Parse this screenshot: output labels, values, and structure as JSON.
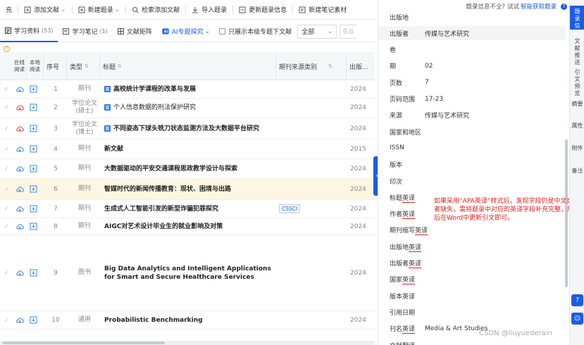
{
  "toolbar": {
    "items": [
      {
        "label": "充",
        "icon": "none"
      },
      {
        "label": "添加文献",
        "icon": "add-doc-icon"
      },
      {
        "label": "新建题录",
        "icon": "new-record-icon"
      },
      {
        "label": "检索添加文献",
        "icon": "search-icon"
      },
      {
        "label": "导入题录",
        "icon": "import-icon"
      },
      {
        "label": "更新题录信息",
        "icon": "refresh-icon"
      },
      {
        "label": "新建笔记素材",
        "icon": "note-icon"
      }
    ]
  },
  "tabs": {
    "items": [
      {
        "label": "学习资料",
        "count": "(53)"
      },
      {
        "label": "学习笔记",
        "count": "(1)"
      },
      {
        "label": "文献矩阵",
        "count": ""
      },
      {
        "label": "AI专题探究",
        "count": ""
      }
    ],
    "checkbox_label": "只展示本级专题下文献",
    "select_value": "全部",
    "search_placeholder": "在当"
  },
  "table": {
    "headers": {
      "online": "在线阅读",
      "local": "本地阅读",
      "num": "序号",
      "type": "类型",
      "title": "标题",
      "source": "期刊来源类别",
      "year": "出版..."
    },
    "rows": [
      {
        "num": "1",
        "type": "期刊",
        "title": "高校统计学课程的改革与发展",
        "tag": "",
        "year": "2024"
      },
      {
        "num": "2",
        "type": "学位论文(硕士)",
        "title": "个人信息数据的刑法保护研究",
        "tag": "",
        "year": "2024"
      },
      {
        "num": "3",
        "type": "学位论文(博士)",
        "title": "不同姿态下球头铣刀状态监测方法及大数据平台研究",
        "tag": "",
        "year": "2024"
      },
      {
        "num": "4",
        "type": "期刊",
        "title": "新文献",
        "tag": "",
        "year": "2015"
      },
      {
        "num": "5",
        "type": "期刊",
        "title": "大数据驱动的平安交通课程思政教学设计与探索",
        "tag": "",
        "year": "2024"
      },
      {
        "num": "6",
        "type": "期刊",
        "title": "智媒时代的新闻传播教育：现状、困境与出路",
        "tag": "",
        "year": "2024"
      },
      {
        "num": "7",
        "type": "期刊",
        "title": "生成式人工智能引发的新型诈骗犯罪探究",
        "tag": "CSSCI",
        "year": "2024"
      },
      {
        "num": "8",
        "type": "期刊",
        "title": "AIGC对艺术设计毕业生的就业影响及对策",
        "tag": "",
        "year": "2024"
      },
      {
        "num": "9",
        "type": "图书",
        "title": "Big Data Analytics and Intelligent Applications for Smart and Secure Healthcare Services",
        "tag": "",
        "year": "2024"
      },
      {
        "num": "10",
        "type": "通用",
        "title": "Probabilistic Benchmarking",
        "tag": "",
        "year": "2024"
      }
    ]
  },
  "panel": {
    "header_text": "题录信息不全?",
    "header_link_pre": "试试",
    "header_link": "智能获取题录",
    "fields": [
      {
        "label": "出版地",
        "value": ""
      },
      {
        "label": "出版者",
        "value": "传媒与艺术研究"
      },
      {
        "label": "卷",
        "value": ""
      },
      {
        "label": "期",
        "value": "02"
      },
      {
        "label": "页数",
        "value": "7"
      },
      {
        "label": "页码范围",
        "value": "17-23"
      },
      {
        "label": "来源",
        "value": "传媒与艺术研究"
      },
      {
        "label": "国家和地区",
        "value": ""
      },
      {
        "label": "ISSN",
        "value": ""
      },
      {
        "label": "版本",
        "value": ""
      },
      {
        "label": "印次",
        "value": ""
      },
      {
        "label": "标题英译",
        "value": ""
      },
      {
        "label": "作者英译",
        "value": ""
      },
      {
        "label": "期刊缩写英译",
        "value": ""
      },
      {
        "label": "出版地英译",
        "value": ""
      },
      {
        "label": "出版者英译",
        "value": ""
      },
      {
        "label": "国家英译",
        "value": ""
      },
      {
        "label": "版本英译",
        "value": ""
      },
      {
        "label": "引用日期",
        "value": ""
      },
      {
        "label": "刊名英译",
        "value": "Media & Art Studies"
      },
      {
        "label": "文献翻译",
        "value": ""
      }
    ],
    "note": "如果采用“APA英译”样式后，发现字段仍是中文或者缺失，需将题录中对应的英译字段补充完整，然后在Word中更新引文即可。"
  },
  "sidebar": {
    "items": [
      "题录信息",
      "文献推送",
      "引文预览",
      "摘要",
      "属性",
      "附件",
      "备注"
    ]
  },
  "watermark": "CSDN @liuyuederain"
}
